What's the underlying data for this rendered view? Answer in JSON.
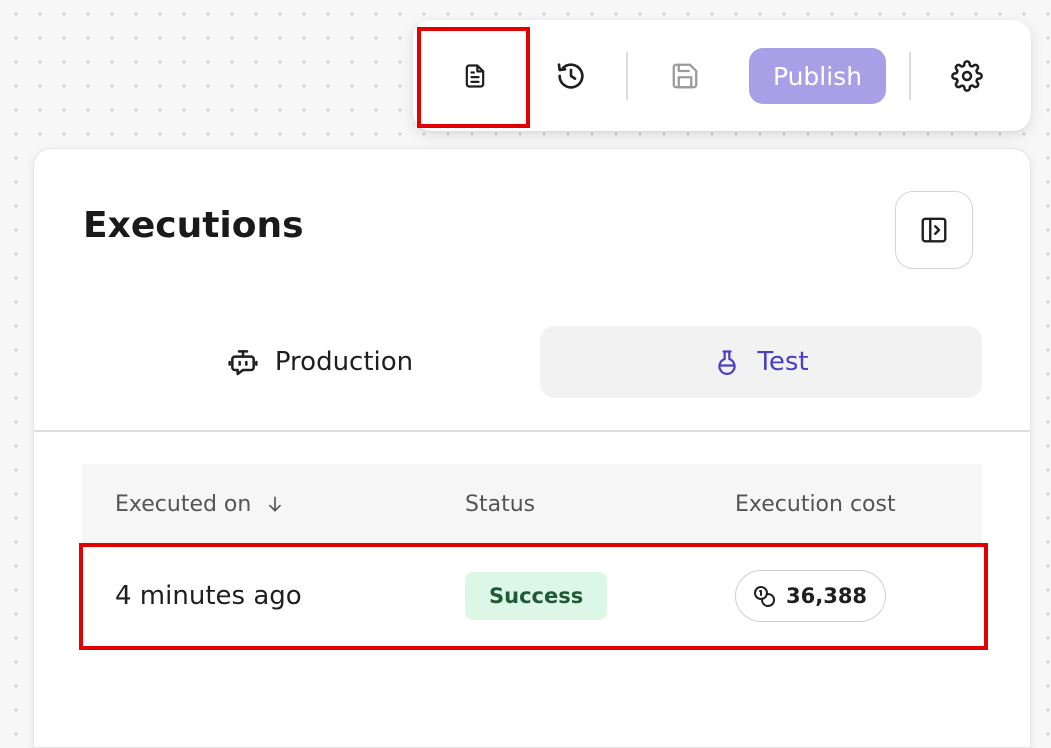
{
  "toolbar": {
    "publish_label": "Publish",
    "icons": {
      "notes": "file-text-icon",
      "history": "history-icon",
      "save": "save-icon",
      "settings": "gear-icon"
    },
    "colors": {
      "publish_bg": "#a89fe6",
      "highlight": "#e30000"
    }
  },
  "panel": {
    "title": "Executions",
    "collapse_icon": "panel-right-icon",
    "tabs": [
      {
        "label": "Production",
        "icon": "bot-icon",
        "active": false
      },
      {
        "label": "Test",
        "icon": "flask-icon",
        "active": true,
        "color": "#4b3fc4"
      }
    ]
  },
  "table": {
    "columns": [
      {
        "label": "Executed on",
        "sort": "descending"
      },
      {
        "label": "Status"
      },
      {
        "label": "Execution cost"
      }
    ],
    "rows": [
      {
        "executed_on": "4 minutes ago",
        "status": "Success",
        "cost": "36,388"
      }
    ]
  }
}
